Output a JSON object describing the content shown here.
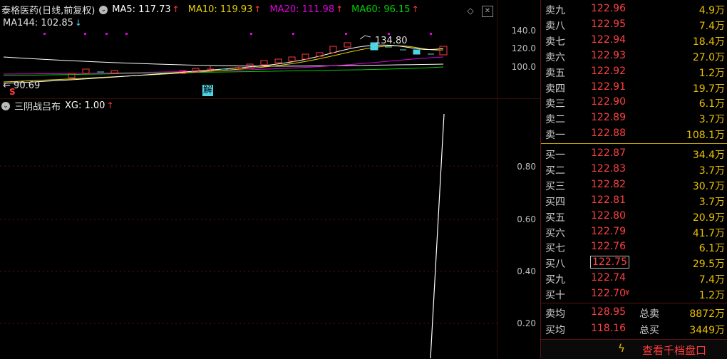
{
  "kline": {
    "stock_name": "泰格医药(日线,前复权)",
    "ma5": "MA5: 117.73",
    "ma10": "MA10: 119.93",
    "ma20": "MA20: 111.98",
    "ma60": "MA60: 96.15",
    "ma144": "MA144: 102.85",
    "up_arrow": "↑",
    "down_arrow": "↓",
    "axis": [
      "140.0",
      "120.0",
      "100.0"
    ],
    "high_label": "134.80",
    "low_label": "90.69",
    "low_arrow": "←",
    "s_marker": "S",
    "jie_marker": "解",
    "colors": {
      "ma5": "#ffffff",
      "ma10": "#e8d000",
      "ma20": "#e000e0",
      "ma60": "#00d000",
      "up": "#ff3b3b",
      "down": "#4dd4e6"
    }
  },
  "indicator": {
    "name": "三阴战吕布",
    "xg": "XG: 1.00",
    "up_arrow": "↑",
    "axis": [
      "0.80",
      "0.60",
      "0.40",
      "0.20"
    ]
  },
  "book": {
    "sell": [
      {
        "label": "卖九",
        "price": "122.96",
        "vol": "4.9万"
      },
      {
        "label": "卖八",
        "price": "122.95",
        "vol": "7.4万"
      },
      {
        "label": "卖七",
        "price": "122.94",
        "vol": "18.4万"
      },
      {
        "label": "卖六",
        "price": "122.93",
        "vol": "27.0万"
      },
      {
        "label": "卖五",
        "price": "122.92",
        "vol": "1.2万"
      },
      {
        "label": "卖四",
        "price": "122.91",
        "vol": "19.7万"
      },
      {
        "label": "卖三",
        "price": "122.90",
        "vol": "6.1万"
      },
      {
        "label": "卖二",
        "price": "122.89",
        "vol": "3.7万"
      },
      {
        "label": "卖一",
        "price": "122.88",
        "vol": "108.1万"
      }
    ],
    "buy": [
      {
        "label": "买一",
        "price": "122.87",
        "vol": "34.4万"
      },
      {
        "label": "买二",
        "price": "122.83",
        "vol": "3.7万"
      },
      {
        "label": "买三",
        "price": "122.82",
        "vol": "30.7万"
      },
      {
        "label": "买四",
        "price": "122.81",
        "vol": "3.7万"
      },
      {
        "label": "买五",
        "price": "122.80",
        "vol": "20.9万"
      },
      {
        "label": "买六",
        "price": "122.79",
        "vol": "41.7万"
      },
      {
        "label": "买七",
        "price": "122.76",
        "vol": "6.1万"
      },
      {
        "label": "买八",
        "price": "122.75",
        "vol": "29.5万"
      },
      {
        "label": "买九",
        "price": "122.74",
        "vol": "7.4万"
      },
      {
        "label": "买十",
        "price": "122.70",
        "vol": "1.2万"
      }
    ],
    "buy10_flag": "¥",
    "avg_sell_label": "卖均",
    "avg_sell": "128.95",
    "total_sell_label": "总卖",
    "total_sell": "8872万",
    "avg_buy_label": "买均",
    "avg_buy": "118.16",
    "total_buy_label": "总买",
    "total_buy": "3449万",
    "footer_link": "查看千档盘口",
    "footer_icon": "lightning-icon"
  }
}
